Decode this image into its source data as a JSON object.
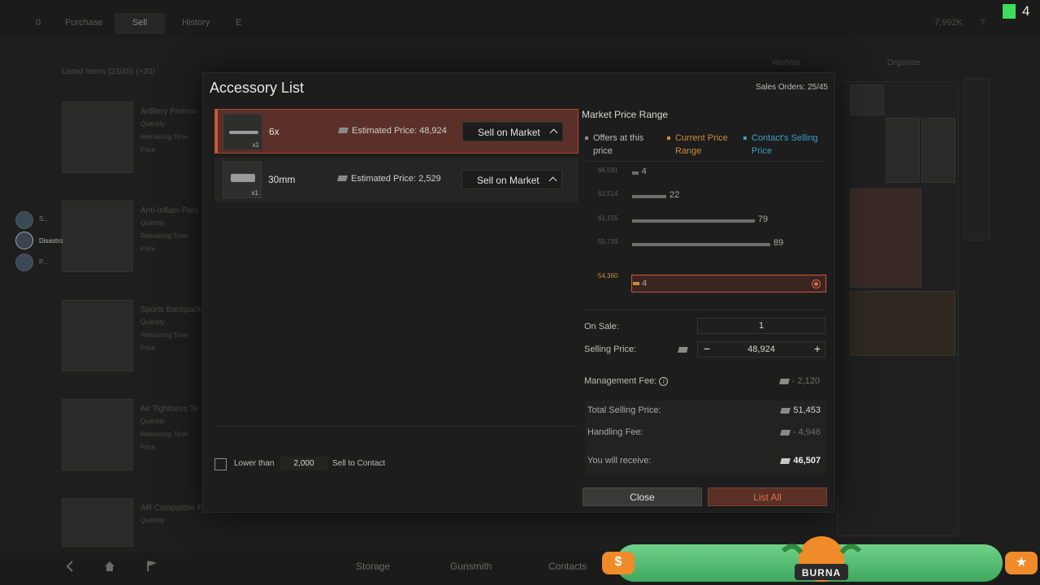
{
  "background": {
    "tabs": [
      "0",
      "Purchase",
      "Sell",
      "History",
      "E"
    ],
    "active_tab": "Sell",
    "currency_total": "7,992K",
    "help": "?",
    "listed_items": "Listed Items (23/45)  (+20)",
    "wishlist": "Wishlist",
    "organize": "Organize",
    "cards": [
      {
        "title": "Artillery Perisco",
        "lines": [
          "Quantity",
          "Remaining Time",
          "Price"
        ]
      },
      {
        "title": "Anti-Inflam Pain",
        "lines": [
          "Quantity",
          "Remaining Time",
          "Price"
        ]
      },
      {
        "title": "Sports Backpack",
        "lines": [
          "Quantity",
          "Remaining Time",
          "Price"
        ]
      },
      {
        "title": "Air Tightness Te",
        "lines": [
          "Quantity",
          "Remaining Time",
          "Price"
        ]
      },
      {
        "title": "AR Compatible F",
        "lines": [
          "Quantity"
        ]
      }
    ],
    "contacts": [
      "S...",
      "Disastro",
      "P..."
    ],
    "bottom_nav": [
      "Storage",
      "Gunsmith",
      "Contacts"
    ],
    "stream_counter": "4"
  },
  "dialog": {
    "title": "Accessory List",
    "sales_orders": "Sales Orders: 25/45",
    "items": [
      {
        "name": "6x",
        "qty": "x1",
        "estimated": "Estimated Price: 48,924",
        "action": "Sell on Market",
        "selected": true
      },
      {
        "name": "30mm",
        "qty": "x1",
        "estimated": "Estimated Price: 2,529",
        "action": "Sell on Market",
        "selected": false
      }
    ],
    "lower_than_label": "Lower than",
    "lower_than_value": "2,000",
    "sell_to_contact": "Sell to Contact",
    "market": {
      "title": "Market Price Range",
      "legend": [
        {
          "label": "Offers at this price",
          "color": "#8d8e89"
        },
        {
          "label": "Current Price Range",
          "color": "#d08a3a"
        },
        {
          "label": "Contact's Selling Price",
          "color": "#3aa0c8"
        }
      ]
    },
    "on_sale_label": "On Sale:",
    "on_sale_value": "1",
    "selling_price_label": "Selling Price:",
    "selling_price_value": "48,924",
    "management_fee_label": "Management Fee:",
    "management_fee_value": "- 2,120",
    "total_selling_label": "Total Selling Price:",
    "total_selling_value": "51,453",
    "handling_fee_label": "Handling Fee:",
    "handling_fee_value": "- 4,946",
    "receive_label": "You will receive:",
    "receive_value": "46,507",
    "close_label": "Close",
    "list_all_label": "List All"
  },
  "overlay": {
    "dollar": "$",
    "star": "★",
    "brand": "BURNA"
  },
  "chart_data": {
    "type": "bar",
    "orientation": "horizontal",
    "categories": [
      "66,591",
      "62,514",
      "61,155",
      "55,719",
      "54,360"
    ],
    "values": [
      4,
      22,
      79,
      89,
      4
    ],
    "highlighted_category": "54,360",
    "title": "Market Price Range",
    "xlabel": "",
    "ylabel": "",
    "grid": false
  }
}
